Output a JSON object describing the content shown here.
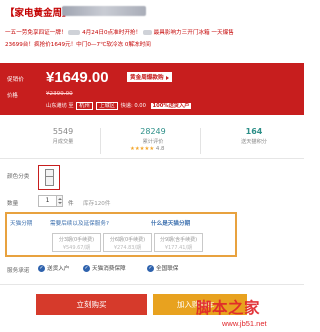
{
  "title": "【家电黄金周】",
  "desc": {
    "line1_start": "一五一劳免享四证一牌！",
    "line1_end": "4月24日0点准时开抢！",
    "line1_link": "最具影响力三开门冰箱",
    "line1_tail": "一天爆售",
    "line2": "23699台！疯抢价1649元！中门0—7℃软冷冻 0解冻时间"
  },
  "price": {
    "label": "促销价",
    "value": "¥1649.00",
    "tag": "黄金周爆款购",
    "orig_label": "价格",
    "orig_value": "¥2399.00",
    "ship_label": "山东潍坊",
    "ship_to": "至",
    "ship_city": "杭州",
    "ship_district": "上城区",
    "ship_fee": "快递: 0.00",
    "ship_badge": "100%送货入户"
  },
  "stats": [
    {
      "num": "5549",
      "label": "月成交量"
    },
    {
      "num": "28249",
      "label": "累计评价"
    },
    {
      "num": "164",
      "label": "送天猫积分"
    }
  ],
  "rating": {
    "stars": "★★★★★",
    "score": "4.8"
  },
  "color": {
    "label": "颜色分类"
  },
  "quantity": {
    "label": "数量",
    "value": "1",
    "unit": "件",
    "stock": "库存120件"
  },
  "service": {
    "label": "天猫分期",
    "question": "需要后续以及延保服务?",
    "link": "什么是天猫分期",
    "options": [
      {
        "a": "分3期(0手续费)",
        "b": "¥549.67/期"
      },
      {
        "a": "分6期(0手续费)",
        "b": "¥274.83/期"
      },
      {
        "a": "分9期(含手续费)",
        "b": "¥177.41/期"
      }
    ]
  },
  "promise": {
    "label": "服务承诺",
    "items": [
      "送货入户",
      "天猫消费保障",
      "全国联保"
    ]
  },
  "buttons": {
    "buy": "立刻购买",
    "cart": "加入购物车"
  },
  "watermark": {
    "main": "脚本之家",
    "url": "www.jb51.net"
  },
  "colors": {
    "accent": "#c71e1e",
    "buy": "#d63a2b",
    "cart": "#e8a21f",
    "highlight_box": "#e8a23f"
  }
}
